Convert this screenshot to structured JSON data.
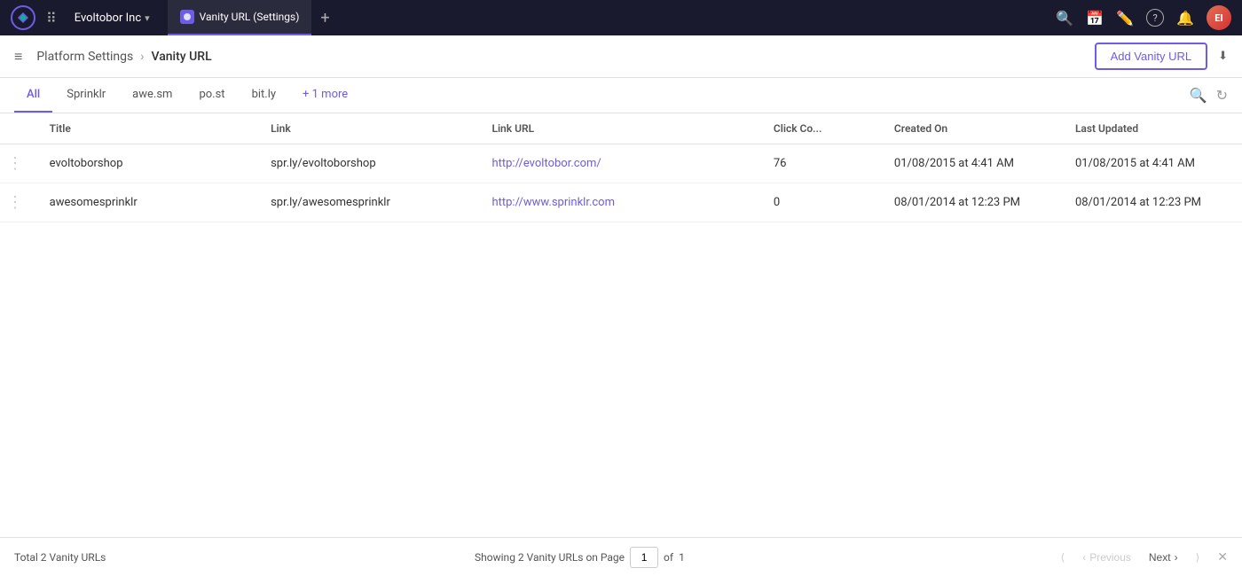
{
  "topNav": {
    "appName": "Evoltobor Inc",
    "appNameChevron": "▾",
    "activeTab": "Vanity URL (Settings)",
    "addTabIcon": "+",
    "gridIcon": "⋮⋮⋮",
    "icons": {
      "search": "🔍",
      "calendar": "📅",
      "edit": "✏️",
      "help": "?",
      "bell": "🔔"
    },
    "avatar": "EI"
  },
  "secondaryHeader": {
    "hamburgerLabel": "≡",
    "breadcrumb": {
      "parent": "Platform Settings",
      "separator": "›",
      "current": "Vanity URL"
    },
    "addButton": "Add Vanity URL",
    "downloadIcon": "⬇"
  },
  "filterBar": {
    "tabs": [
      {
        "label": "All",
        "active": true
      },
      {
        "label": "Sprinklr",
        "active": false
      },
      {
        "label": "awe.sm",
        "active": false
      },
      {
        "label": "po.st",
        "active": false
      },
      {
        "label": "bit.ly",
        "active": false
      },
      {
        "label": "+ 1 more",
        "active": false,
        "isMore": true
      }
    ],
    "searchIcon": "🔍",
    "refreshIcon": "↻"
  },
  "table": {
    "columns": [
      {
        "key": "menu",
        "label": ""
      },
      {
        "key": "title",
        "label": "Title"
      },
      {
        "key": "link",
        "label": "Link"
      },
      {
        "key": "linkUrl",
        "label": "Link URL"
      },
      {
        "key": "clickCount",
        "label": "Click Co..."
      },
      {
        "key": "createdOn",
        "label": "Created On"
      },
      {
        "key": "lastUpdated",
        "label": "Last Updated"
      }
    ],
    "rows": [
      {
        "title": "evoltoborshop",
        "link": "spr.ly/evoltoborshop",
        "linkUrl": "http://evoltobor.com/",
        "clickCount": "76",
        "createdOn": "01/08/2015 at 4:41 AM",
        "lastUpdated": "01/08/2015 at 4:41 AM"
      },
      {
        "title": "awesomesprinklr",
        "link": "spr.ly/awesomesprinklr",
        "linkUrl": "http://www.sprinklr.com",
        "clickCount": "0",
        "createdOn": "08/01/2014 at 12:23 PM",
        "lastUpdated": "08/01/2014 at 12:23 PM"
      }
    ]
  },
  "footer": {
    "totalLabel": "Total 2 Vanity URLs",
    "showingLabel": "Showing 2 Vanity URLs on Page",
    "currentPage": "1",
    "ofLabel": "of",
    "totalPages": "1",
    "firstIcon": "⟨",
    "prevLabel": "Previous",
    "prevIcon": "‹",
    "nextLabel": "Next",
    "nextIcon": "›",
    "lastIcon": "⟩",
    "closeIcon": "✕"
  }
}
